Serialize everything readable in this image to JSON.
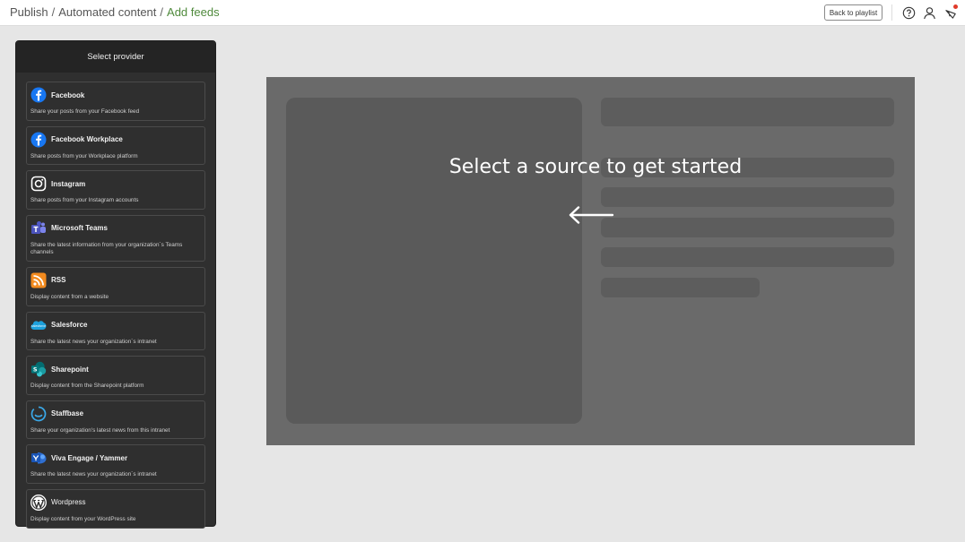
{
  "breadcrumb": {
    "publish": "Publish",
    "automated": "Automated content",
    "current": "Add feeds",
    "separator": "/"
  },
  "header": {
    "back_label": "Back to playlist",
    "icons": [
      "help-icon",
      "user-icon",
      "notification-icon"
    ]
  },
  "panel": {
    "title": "Select provider",
    "providers": [
      {
        "name": "Facebook",
        "desc": "Share your posts from your Facebook feed",
        "icon": "facebook-icon"
      },
      {
        "name": "Facebook Workplace",
        "desc": "Share posts from your Workplace platform",
        "icon": "facebook-workplace-icon"
      },
      {
        "name": "Instagram",
        "desc": "Share posts from your Instagram accounts",
        "icon": "instagram-icon"
      },
      {
        "name": "Microsoft Teams",
        "desc": "Share the latest information from your organization´s Teams channels",
        "icon": "microsoft-teams-icon"
      },
      {
        "name": "RSS",
        "desc": "Display content from a website",
        "icon": "rss-icon"
      },
      {
        "name": "Salesforce",
        "desc": "Share the latest news your organization´s intranet",
        "icon": "salesforce-icon"
      },
      {
        "name": "Sharepoint",
        "desc": "Display content from the Sharepoint platform",
        "icon": "sharepoint-icon"
      },
      {
        "name": "Staffbase",
        "desc": "Share your organization's latest news from this intranet",
        "icon": "staffbase-icon"
      },
      {
        "name": "Viva Engage / Yammer",
        "desc": "Share the latest news your organization´s intranet",
        "icon": "viva-engage-icon"
      },
      {
        "name": "Wordpress",
        "desc": "Display content from your WordPress site",
        "icon": "wordpress-icon"
      }
    ]
  },
  "preview": {
    "prompt": "Select a source to get started"
  },
  "colors": {
    "accent_green": "#4f8a3c",
    "panel_bg": "#2f2f2f",
    "preview_bg": "#6a6a6a",
    "notification_dot": "#e03a2a"
  }
}
